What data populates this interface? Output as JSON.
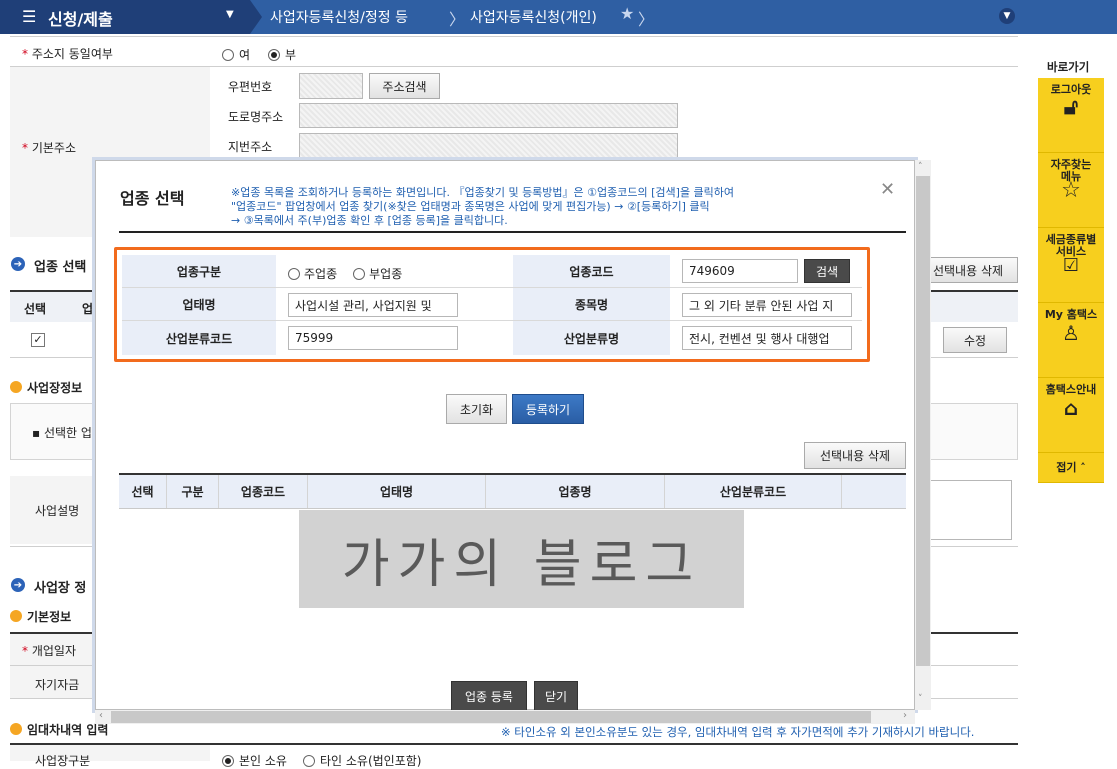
{
  "topbar": {
    "menu_label": "신청/제출",
    "crumb1": "사업자등록신청/정정 등",
    "crumb2": "사업자등록신청(개인)"
  },
  "page": {
    "address_same_label": "주소지 동일여부",
    "radio_yes": "여",
    "radio_no": "부",
    "basic_address_label": "기본주소",
    "postal_label": "우편번호",
    "address_search_button": "주소검색",
    "road_address_label": "도로명주소",
    "lot_address_label": "지번주소",
    "industry_section": "업종 선택",
    "delete_selected_bg": "선택내용 삭제",
    "col_select": "선택",
    "col_partial": "업",
    "edit_button": "수정",
    "biz_info_section": "사업장정보",
    "selected_note": "선택한 업",
    "biz_desc_label": "사업설명",
    "biz_section2": "사업장 정",
    "basic_info": "기본정보",
    "open_date": "개업일자",
    "own_capital": "자기자금",
    "lease_section": "임대차내역 입력",
    "lease_note": "※ 타인소유 외 본인소유분도 있는 경우, 임대차내역 입력 후 자가면적에 추가 기재하시기 바랍니다.",
    "biz_type_label": "사업장구분",
    "own_property": "본인 소유",
    "other_property": "타인 소유(법인포함)"
  },
  "quickbar": {
    "title": "바로가기",
    "items": [
      {
        "label": "로그아웃",
        "icon": "unlock-icon"
      },
      {
        "label": "자주찾는 메뉴",
        "icon": "star-icon"
      },
      {
        "label": "세금종류별 서비스",
        "icon": "checkbox-icon"
      },
      {
        "label": "My 홈택스",
        "icon": "user-icon"
      },
      {
        "label": "홈택스안내",
        "icon": "home-guide-icon"
      }
    ],
    "collapse": "접기"
  },
  "modal": {
    "title": "업종 선택",
    "notice": "※업종 목록을 조회하거나 등록하는 화면입니다. 『업종찾기 및 등록방법』은 ①업종코드의 [검색]을 클릭하여 \"업종코드\" 팝업창에서 업종 찾기(※찾은 업태명과 종목명은 사업에 맞게 편집가능) → ②[등록하기] 클릭 → ③목록에서 주(부)업종 확인 후 [업종 등록]을 클릭합니다.",
    "notice_line1": "※업종 목록을 조회하거나 등록하는 화면입니다. 『업종찾기 및 등록방법』은 ①업종코드의 [검색]을 클릭하여",
    "notice_line2": "\"업종코드\" 팝업창에서 업종 찾기(※찾은 업태명과 종목명은 사업에 맞게 편집가능) → ②[등록하기] 클릭",
    "notice_line3": "→ ③목록에서 주(부)업종 확인 후 [업종 등록]을 클릭합니다.",
    "close_symbol": "✕",
    "form": {
      "type_label": "업종구분",
      "main_type": "주업종",
      "sub_type": "부업종",
      "code_label": "업종코드",
      "code_value": "749609",
      "search_button": "검색",
      "business_name_label": "업태명",
      "business_name_value": "사업시설 관리, 사업지원 및",
      "item_name_label": "종목명",
      "item_name_value": "그 외 기타 분류 안된 사업 지",
      "industry_code_label": "산업분류코드",
      "industry_code_value": "75999",
      "industry_name_label": "산업분류명",
      "industry_name_value": "전시, 컨벤션 및 행사 대행업"
    },
    "reset_button": "초기화",
    "register_button": "등록하기",
    "delete_selected_button": "선택내용 삭제",
    "columns": [
      "선택",
      "구분",
      "업종코드",
      "업태명",
      "업종명",
      "산업분류코드"
    ],
    "watermark": "가가의 블로그",
    "industry_register_button": "업종 등록",
    "close_button": "닫기"
  },
  "colors": {
    "nav_dark": "#1f3f78",
    "nav_blue": "#2f5fa3",
    "highlight_orange": "#f26b1d",
    "quick_yellow": "#f7cf1e"
  }
}
